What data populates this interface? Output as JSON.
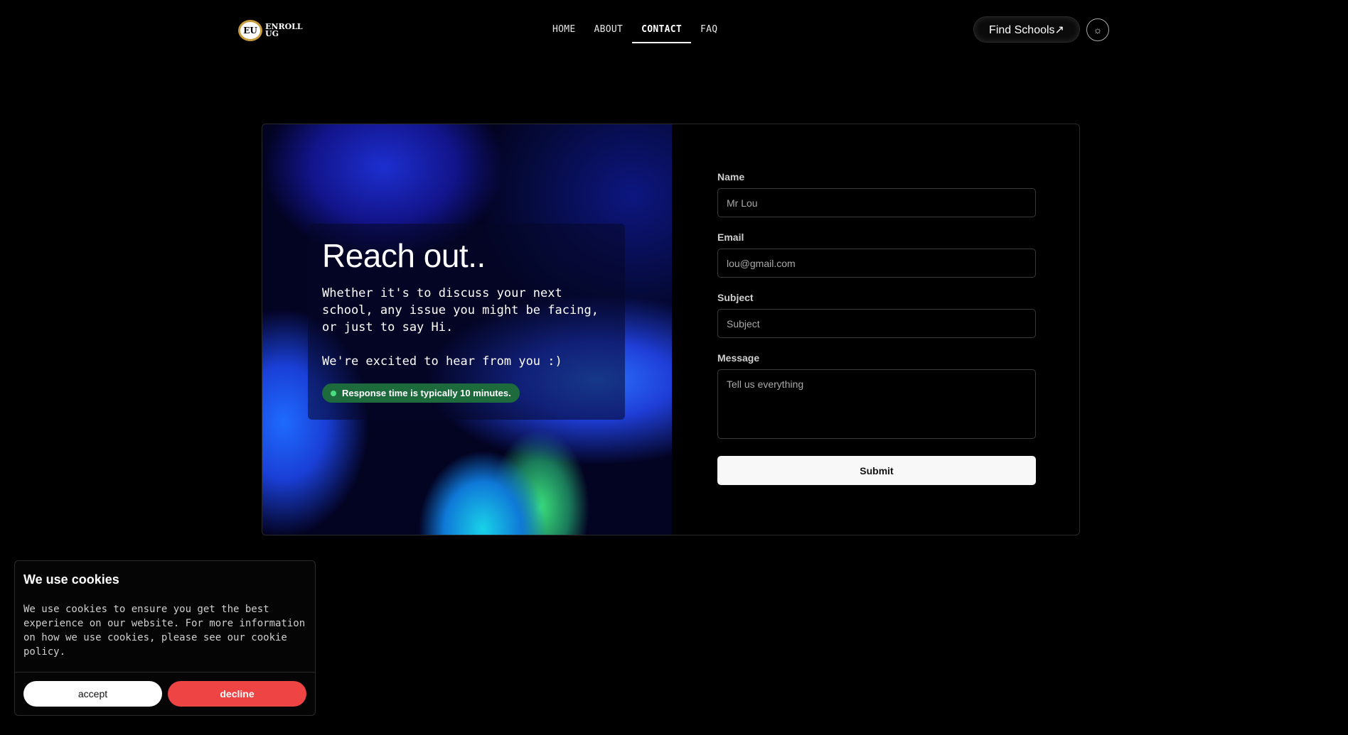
{
  "header": {
    "logo_mark": "EU",
    "logo_line1": "ENROLL",
    "logo_line2": "UG",
    "nav": [
      "HOME",
      "ABOUT",
      "CONTACT",
      "FAQ"
    ],
    "active_nav": "CONTACT",
    "find_schools": "Find Schools↗",
    "theme_icon": "sun-icon",
    "theme_glyph": "☼"
  },
  "hero": {
    "title": "Reach out..",
    "text": "Whether it's to discuss your next school, any issue you might be facing, or just to say Hi.",
    "text2": "We're excited to hear from you :)",
    "badge": "Response time is typically 10 minutes."
  },
  "form": {
    "name_label": "Name",
    "name_value": "Mr Lou",
    "email_label": "Email",
    "email_value": "lou@gmail.com",
    "subject_label": "Subject",
    "subject_placeholder": "Subject",
    "message_label": "Message",
    "message_placeholder": "Tell us everything",
    "submit": "Submit"
  },
  "cookie": {
    "title": "We use cookies",
    "text": "We use cookies to ensure you get the best experience on our website. For more information on how we use cookies, please see our cookie policy.",
    "accept": "accept",
    "decline": "decline"
  },
  "colors": {
    "background": "#000000",
    "decline": "#ef4444",
    "badge": "#1d6b3c"
  }
}
